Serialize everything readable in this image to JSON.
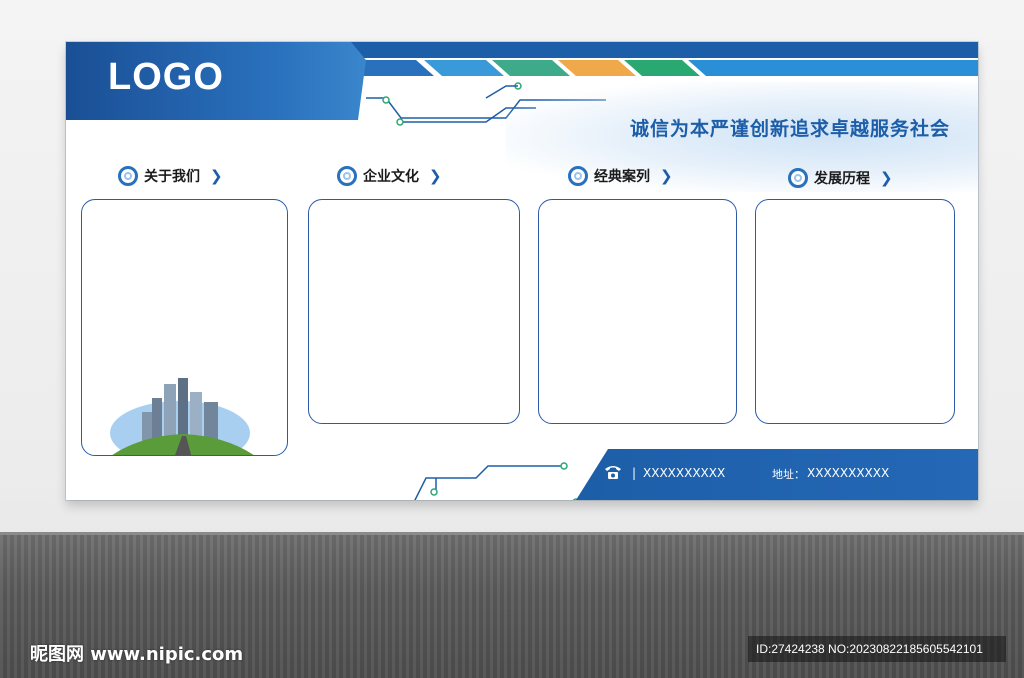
{
  "board": {
    "logo": "LOGO",
    "slogan": "诚信为本严谨创新追求卓越服务社会",
    "sections": [
      {
        "title": "关于我们"
      },
      {
        "title": "企业文化"
      },
      {
        "title": "经典案列"
      },
      {
        "title": "发展历程"
      }
    ],
    "footer": {
      "phone": "XXXXXXXXXX",
      "address_label": "地址：",
      "address": "XXXXXXXXXX",
      "separator": "|"
    }
  },
  "watermark": {
    "left": "昵图网 www.nipic.com",
    "right": "ID:27424238 NO:20230822185605542101"
  },
  "colors": {
    "primary": "#1d5ea8",
    "accent_light": "#3a9ad9",
    "teal": "#3daa8a",
    "orange": "#f0a94a",
    "green": "#2aa872"
  },
  "icons": [
    "ring-bullet-icon",
    "chevron-right-icon",
    "phone-icon",
    "city-buildings-illustration"
  ]
}
